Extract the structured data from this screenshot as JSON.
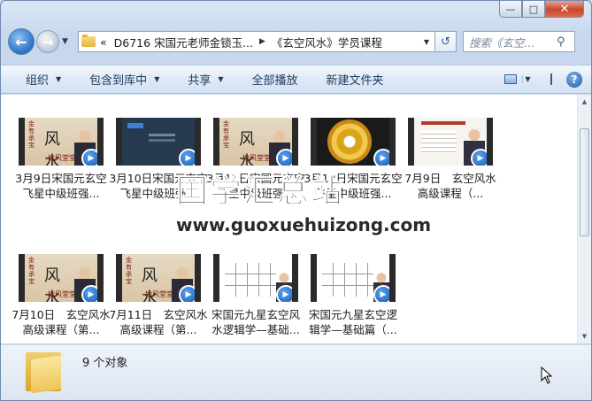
{
  "window": {
    "caption": {
      "minimize": "—",
      "maximize": "□",
      "close": "✕"
    }
  },
  "nav": {
    "address_prefix": "«",
    "breadcrumbs": [
      "D6716 宋国元老师金锁玉...",
      "《玄空风水》学员课程"
    ],
    "search_placeholder": "搜索《玄空...",
    "back_icon": "back-arrow-icon",
    "forward_icon": "forward-arrow-icon"
  },
  "toolbar": {
    "items": [
      "组织",
      "包含到库中",
      "共享",
      "全部播放",
      "新建文件夹"
    ],
    "has_dropdown": [
      true,
      true,
      true,
      false,
      false
    ]
  },
  "files": [
    {
      "label": "3月9日宋国元玄空飞星中级班强...",
      "thumb": "cal"
    },
    {
      "label": "3月10日宋国元玄空飞星中级班强...",
      "thumb": "dark"
    },
    {
      "label": "3月11日宋国元玄空飞星中级班强...",
      "thumb": "cal"
    },
    {
      "label": "3月12日宋国元玄空飞星中级班强...",
      "thumb": "gold"
    },
    {
      "label": "7月9日　玄空风水高级课程（...",
      "thumb": "doc"
    },
    {
      "label": "7月10日　玄空风水高级课程（第...",
      "thumb": "cal"
    },
    {
      "label": "7月11日　玄空风水高级课程（第...",
      "thumb": "cal"
    },
    {
      "label": "宋国元九星玄空风水逻辑学—基础...",
      "thumb": "grid"
    },
    {
      "label": "宋国元九星玄空逻辑学—基础篇（...",
      "thumb": "grid"
    }
  ],
  "status": {
    "count": "9 个对象"
  },
  "watermark": {
    "chinese": "国学汇总站",
    "url": "www.guoxuehuizong.com"
  },
  "thumb_text": {
    "cal_side": "金有承宝",
    "cal_big": "风水",
    "cal_bottom": "地风堂堂"
  }
}
